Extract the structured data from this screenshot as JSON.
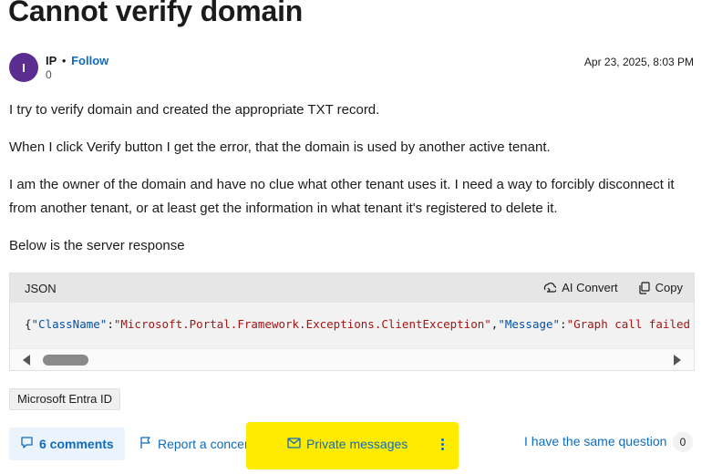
{
  "question": {
    "title": "Cannot verify domain",
    "author": {
      "initial": "I",
      "name": "IP",
      "separator": "•",
      "follow_label": "Follow",
      "points": "0"
    },
    "date": "Apr 23, 2025, 8:03 PM",
    "paragraphs": [
      "I try to verify domain and created the appropriate TXT record.",
      "When I click Verify button I get the error, that the domain is used by another active tenant.",
      "I am the owner of the domain and have no clue what other tenant uses it. I need a way to forcibly disconnect it from another tenant, or at least get the information in what tenant it's registered to delete it.",
      "Below is the server response"
    ]
  },
  "code_block": {
    "language": "JSON",
    "ai_convert_label": "AI Convert",
    "copy_label": "Copy",
    "tokens": {
      "open": "{",
      "key1": "\"ClassName\"",
      "colon1": ":",
      "val1": "\"Microsoft.Portal.Framework.Exceptions.ClientException\"",
      "comma1": ",",
      "key2": "\"Message\"",
      "colon2": ":",
      "val2": "\"Graph call failed"
    }
  },
  "tags": [
    "Microsoft Entra ID"
  ],
  "actions": {
    "comments_label": "6 comments",
    "report_label": "Report a concern",
    "private_messages_label": "Private messages",
    "same_question_label": "I have the same question",
    "same_question_count": "0"
  },
  "colors": {
    "link": "#0f6cbd",
    "avatar": "#5c2d91",
    "highlight": "#ffeb00"
  }
}
